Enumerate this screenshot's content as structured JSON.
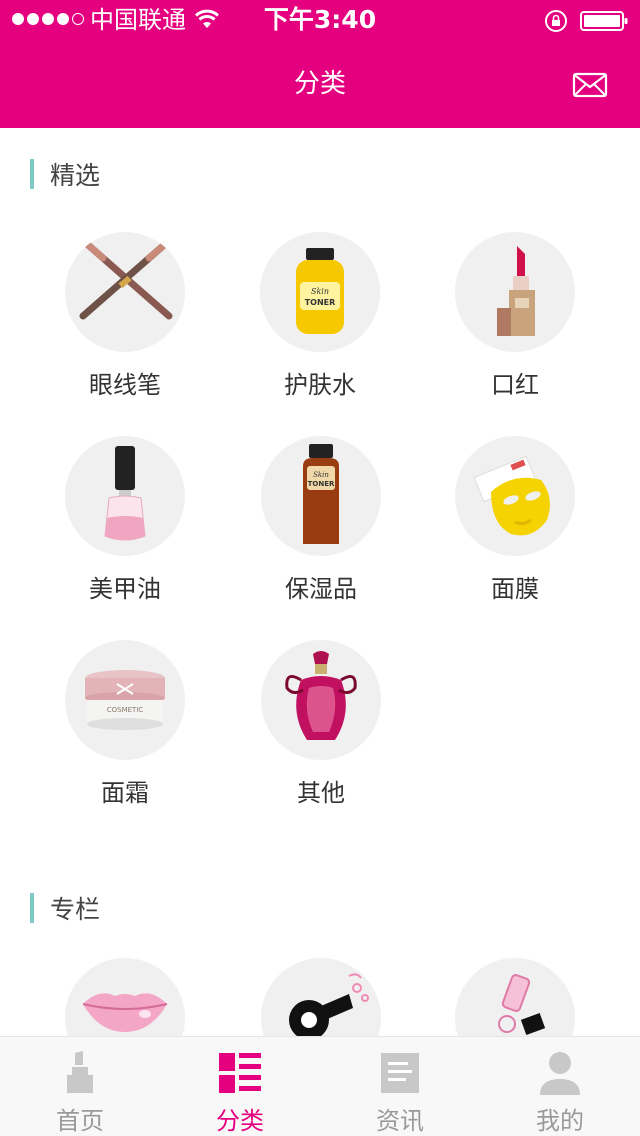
{
  "status_bar": {
    "carrier": "中国联通",
    "time": "下午3:40"
  },
  "nav": {
    "title": "分类",
    "right_icon": "mail-icon"
  },
  "sections": {
    "featured": {
      "title": "精选",
      "items": [
        {
          "label": "眼线笔",
          "icon": "eyeliner-pencil-icon"
        },
        {
          "label": "护肤水",
          "icon": "yellow-toner-bottle-icon"
        },
        {
          "label": "口红",
          "icon": "lipstick-icon"
        },
        {
          "label": "美甲油",
          "icon": "nail-polish-icon"
        },
        {
          "label": "保湿品",
          "icon": "brown-toner-bottle-icon"
        },
        {
          "label": "面膜",
          "icon": "face-mask-icon"
        },
        {
          "label": "面霜",
          "icon": "cream-jar-icon"
        },
        {
          "label": "其他",
          "icon": "perfume-bottle-icon"
        }
      ]
    },
    "columns": {
      "title": "专栏",
      "items": [
        {
          "icon": "lips-icon"
        },
        {
          "icon": "hair-dryer-icon"
        },
        {
          "icon": "cosmetic-tools-icon"
        }
      ]
    }
  },
  "tabbar": {
    "active": "分类",
    "accent_color": "#e4007f",
    "items": [
      {
        "label": "首页",
        "icon": "home-lipstick-icon"
      },
      {
        "label": "分类",
        "icon": "category-list-icon"
      },
      {
        "label": "资讯",
        "icon": "news-document-icon"
      },
      {
        "label": "我的",
        "icon": "user-profile-icon"
      }
    ]
  },
  "colors": {
    "brand": "#e4007f",
    "section_bar": "#7ecac3",
    "circle_bg": "#f0f0f0"
  }
}
